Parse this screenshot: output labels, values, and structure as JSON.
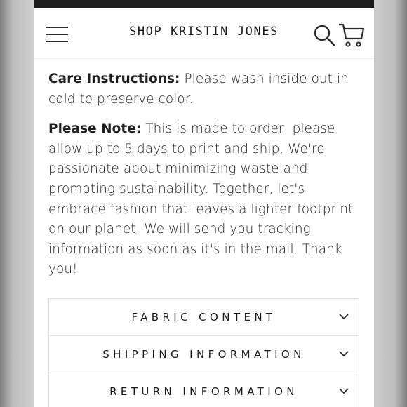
{
  "header": {
    "brand": "SHOP KRISTIN JONES",
    "menu_icon": "hamburger-menu-icon",
    "search_icon": "search-icon",
    "cart_icon": "cart-icon"
  },
  "content": {
    "care": {
      "lead": "Care Instructions:",
      "text": " Please wash inside out in cold to preserve color."
    },
    "note": {
      "lead": "Please Note:",
      "text": " This is made to order, please allow up to 5 days to print and ship. We're passionate about minimizing waste and promoting sustainability. Together, let's embrace fashion that leaves a lighter footprint on our planet. We will send you tracking information as soon as it's in the mail. Thank you!"
    }
  },
  "accordion": {
    "items": [
      {
        "label": "FABRIC CONTENT"
      },
      {
        "label": "SHIPPING INFORMATION"
      },
      {
        "label": "RETURN INFORMATION"
      }
    ],
    "chevron_icon": "chevron-down-icon"
  }
}
